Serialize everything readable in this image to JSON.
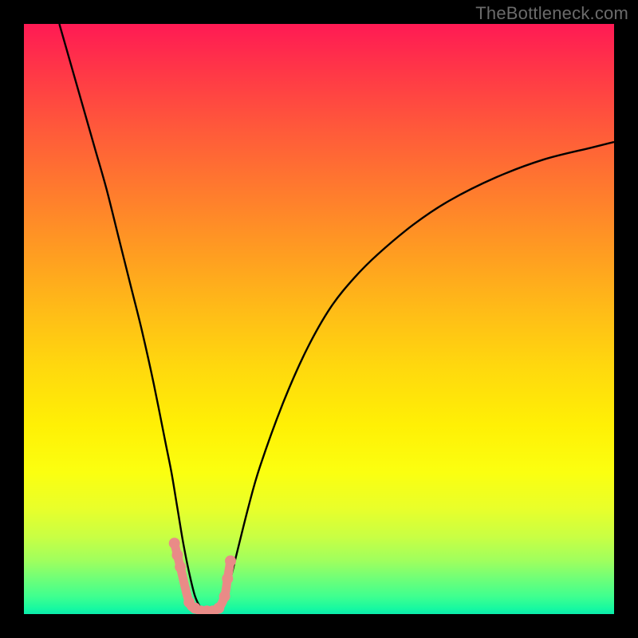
{
  "watermark": "TheBottleneck.com",
  "chart_data": {
    "type": "line",
    "title": "",
    "xlabel": "",
    "ylabel": "",
    "xlim": [
      0,
      100
    ],
    "ylim": [
      0,
      100
    ],
    "series": [
      {
        "name": "bottleneck-curve",
        "x": [
          6,
          8,
          10,
          12,
          14,
          16,
          18,
          20,
          22,
          24,
          25,
          26,
          27,
          28,
          29,
          30,
          31,
          32,
          33,
          34,
          35,
          36,
          38,
          40,
          44,
          48,
          52,
          56,
          60,
          66,
          72,
          80,
          88,
          96,
          100
        ],
        "y": [
          100,
          93,
          86,
          79,
          72,
          64,
          56,
          48,
          39,
          29,
          24,
          18,
          12,
          7,
          3,
          1,
          0,
          0,
          1,
          3,
          6,
          10,
          18,
          25,
          36,
          45,
          52,
          57,
          61,
          66,
          70,
          74,
          77,
          79,
          80
        ]
      },
      {
        "name": "highlight-markers",
        "x": [
          25.5,
          26,
          26.5,
          28,
          29,
          30,
          31,
          32,
          33,
          34,
          34.5,
          35
        ],
        "y": [
          12,
          10,
          8,
          2,
          1,
          0.5,
          0.5,
          0.5,
          1,
          3,
          6,
          9
        ]
      }
    ],
    "marker_color": "#e98b87",
    "line_color": "#000000",
    "gradient_stops": [
      {
        "pos": 0,
        "color": "#ff1a54"
      },
      {
        "pos": 50,
        "color": "#ffd80e"
      },
      {
        "pos": 80,
        "color": "#fbff10"
      },
      {
        "pos": 100,
        "color": "#0becac"
      }
    ]
  }
}
